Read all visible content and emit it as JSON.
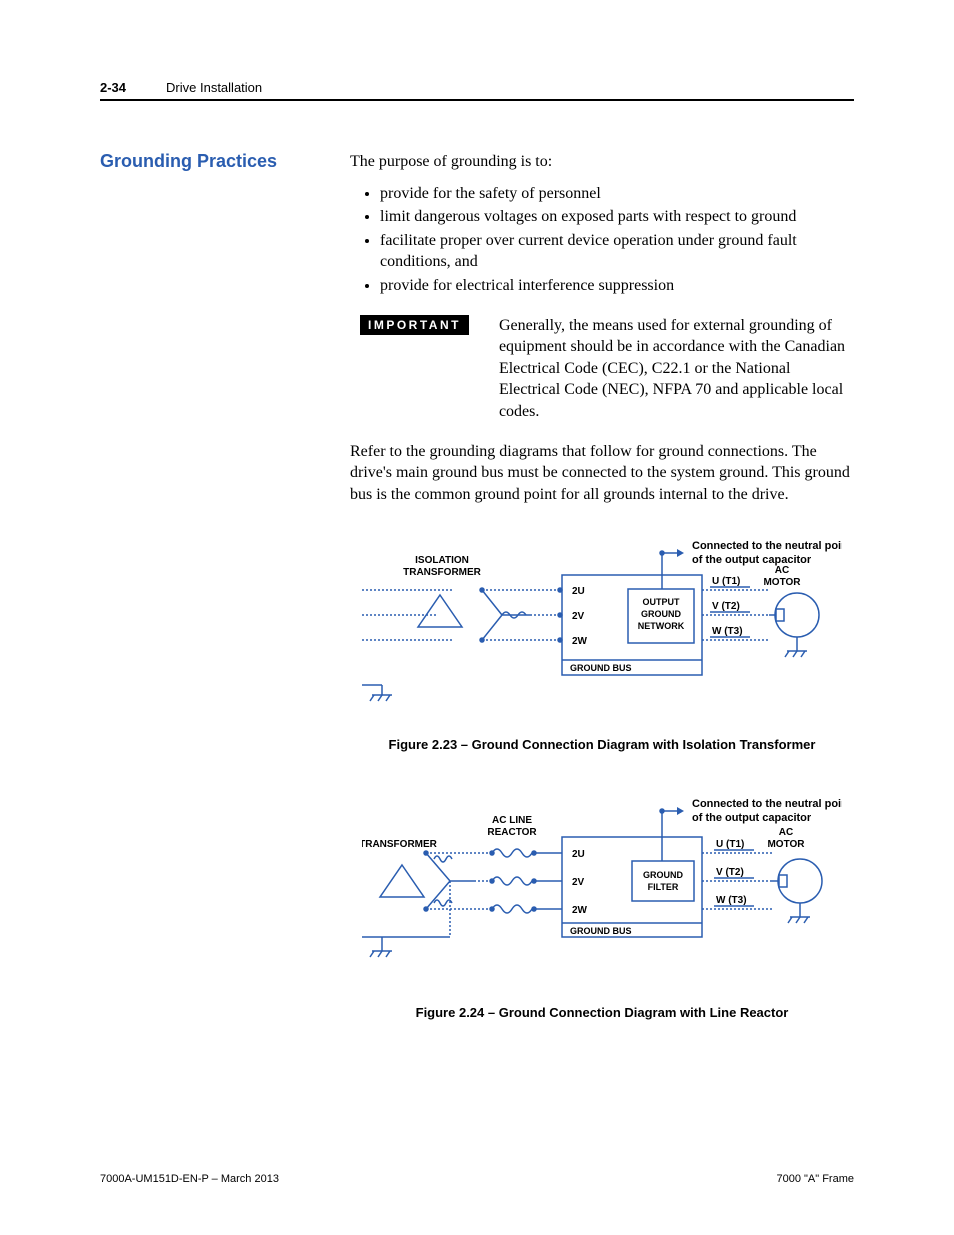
{
  "header": {
    "page_number": "2-34",
    "chapter_title": "Drive Installation"
  },
  "section": {
    "side_heading": "Grounding Practices",
    "intro": "The purpose of grounding is to:",
    "bullet1": "provide for the safety of personnel",
    "bullet2": "limit dangerous voltages on exposed parts with respect to ground",
    "bullet3": "facilitate proper over current device operation under ground fault conditions, and",
    "bullet4": "provide for electrical interference suppression",
    "important_label": "IMPORTANT",
    "important_text": "Generally, the means used for external grounding of equipment should be in accordance with the Canadian Electrical Code (CEC), C22.1 or the National Electrical Code (NEC), NFPA 70 and applicable local codes.",
    "para2": "Refer to the grounding diagrams that follow for ground connections. The drive's main ground bus must be connected to the system ground.  This ground bus is the common ground point for all grounds internal to the drive."
  },
  "fig1": {
    "caption": "Figure 2.23 – Ground Connection Diagram with Isolation Transformer",
    "trans_label1": "ISOLATION",
    "trans_label2": "TRANSFORMER",
    "neutral_note1": "Connected to the neutral point",
    "neutral_note2": "of the output capacitor",
    "u2": "2U",
    "v2": "2V",
    "w2": "2W",
    "filter1": "OUTPUT",
    "filter2": "GROUND",
    "filter3": "NETWORK",
    "bus": "GROUND BUS",
    "u": "U (T1)",
    "v": "V (T2)",
    "w": "W (T3)",
    "motor1": "AC",
    "motor2": "MOTOR"
  },
  "fig2": {
    "caption": "Figure 2.24 – Ground Connection Diagram with Line Reactor",
    "trans_label": "TRANSFORMER",
    "reactor1": "AC LINE",
    "reactor2": "REACTOR",
    "neutral_note1": "Connected to the neutral point",
    "neutral_note2": "of the output capacitor",
    "u2": "2U",
    "v2": "2V",
    "w2": "2W",
    "filter1": "GROUND",
    "filter2": "FILTER",
    "bus": "GROUND BUS",
    "u": "U (T1)",
    "v": "V (T2)",
    "w": "W (T3)",
    "motor1": "AC",
    "motor2": "MOTOR"
  },
  "footer": {
    "left": "7000A-UM151D-EN-P – March 2013",
    "right": "7000 \"A\" Frame"
  }
}
